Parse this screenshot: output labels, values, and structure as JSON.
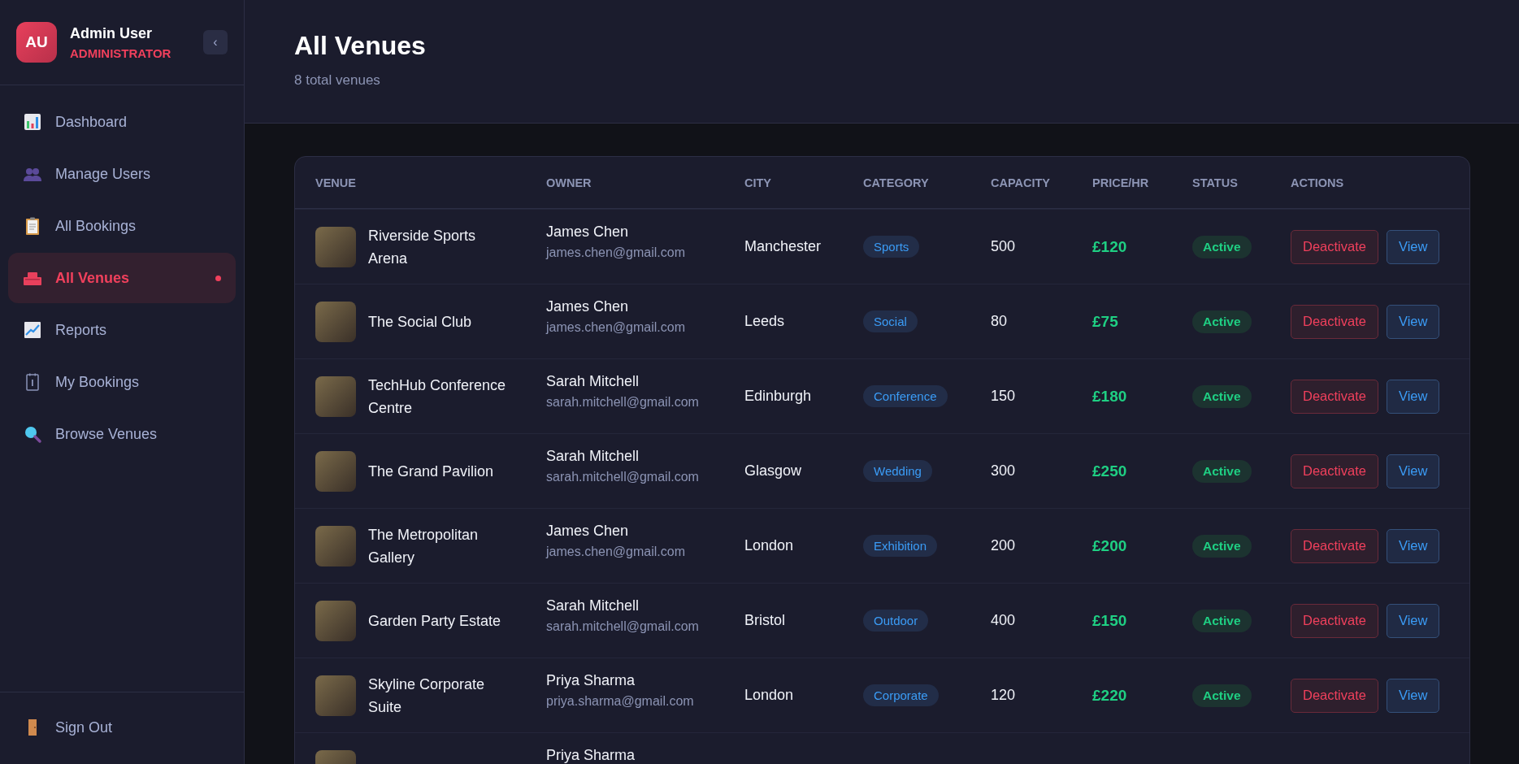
{
  "user": {
    "initials": "AU",
    "name": "Admin User",
    "role": "ADMINISTRATOR"
  },
  "collapse_button": "‹",
  "nav": [
    {
      "label": "Dashboard",
      "selected": false
    },
    {
      "label": "Manage Users",
      "selected": false
    },
    {
      "label": "All Bookings",
      "selected": false
    },
    {
      "label": "All Venues",
      "selected": true
    },
    {
      "label": "Reports",
      "selected": false
    },
    {
      "label": "My Bookings",
      "selected": false
    },
    {
      "label": "Browse Venues",
      "selected": false
    }
  ],
  "sign_out": "Sign Out",
  "page": {
    "title": "All Venues",
    "subtitle": "8 total venues"
  },
  "table": {
    "columns": [
      "VENUE",
      "OWNER",
      "CITY",
      "CATEGORY",
      "CAPACITY",
      "PRICE/HR",
      "STATUS",
      "ACTIONS"
    ],
    "rows": [
      {
        "venue": "Riverside Sports Arena",
        "owner": "James Chen",
        "email": "james.chen@gmail.com",
        "city": "Manchester",
        "category": "Sports",
        "capacity": "500",
        "price": "£120",
        "status": "Active",
        "actions": [
          "Deactivate",
          "View"
        ]
      },
      {
        "venue": "The Social Club",
        "owner": "James Chen",
        "email": "james.chen@gmail.com",
        "city": "Leeds",
        "category": "Social",
        "capacity": "80",
        "price": "£75",
        "status": "Active",
        "actions": [
          "Deactivate",
          "View"
        ]
      },
      {
        "venue": "TechHub Conference Centre",
        "owner": "Sarah Mitchell",
        "email": "sarah.mitchell@gmail.com",
        "city": "Edinburgh",
        "category": "Conference",
        "capacity": "150",
        "price": "£180",
        "status": "Active",
        "actions": [
          "Deactivate",
          "View"
        ]
      },
      {
        "venue": "The Grand Pavilion",
        "owner": "Sarah Mitchell",
        "email": "sarah.mitchell@gmail.com",
        "city": "Glasgow",
        "category": "Wedding",
        "capacity": "300",
        "price": "£250",
        "status": "Active",
        "actions": [
          "Deactivate",
          "View"
        ]
      },
      {
        "venue": "The Metropolitan Gallery",
        "owner": "James Chen",
        "email": "james.chen@gmail.com",
        "city": "London",
        "category": "Exhibition",
        "capacity": "200",
        "price": "£200",
        "status": "Active",
        "actions": [
          "Deactivate",
          "View"
        ]
      },
      {
        "venue": "Garden Party Estate",
        "owner": "Sarah Mitchell",
        "email": "sarah.mitchell@gmail.com",
        "city": "Bristol",
        "category": "Outdoor",
        "capacity": "400",
        "price": "£150",
        "status": "Active",
        "actions": [
          "Deactivate",
          "View"
        ]
      },
      {
        "venue": "Skyline Corporate Suite",
        "owner": "Priya Sharma",
        "email": "priya.sharma@gmail.com",
        "city": "London",
        "category": "Corporate",
        "capacity": "120",
        "price": "£220",
        "status": "Active",
        "actions": [
          "Deactivate",
          "View"
        ]
      },
      {
        "owner": "Priya Sharma"
      }
    ]
  }
}
